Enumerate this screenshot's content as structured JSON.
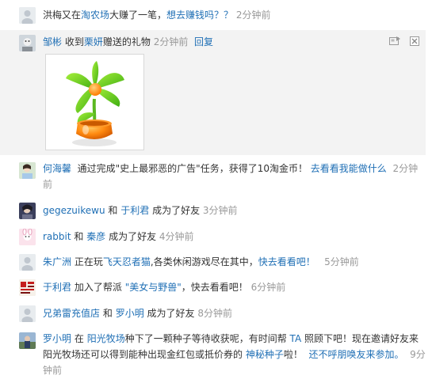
{
  "feed": [
    {
      "actor": "洪梅又在",
      "link1": "淘农场",
      "mid": "大赚了一笔，",
      "link2": "想去赚钱吗？？",
      "time": "2分钟前"
    },
    {
      "name": "邹彬",
      "t1": "收到",
      "name2": "栗妍",
      "t2": "赠送的礼物",
      "time": "2分钟前",
      "reply": "回复"
    },
    {
      "name": "何海馨",
      "t1": "通过完成\"史上最邪恶的广告\"任务，获得了10淘金币！",
      "link": "去看看我能做什么",
      "time": "2分钟前"
    },
    {
      "name": "gegezuikewu",
      "t1": "和",
      "name2": "于利君",
      "t2": "成为了好友",
      "time": "3分钟前"
    },
    {
      "name": "rabbit",
      "t1": "和",
      "name2": "秦彦",
      "t2": "成为了好友",
      "time": "4分钟前"
    },
    {
      "name": "朱广洲",
      "t1": "正在玩",
      "game": "飞天忍者猫",
      "t2": ",各类休闲游戏尽在其中，",
      "link": "快去看看吧！",
      "time": "5分钟前"
    },
    {
      "name": "于利君",
      "t1": "加入了帮派",
      "gang": "\"美女与野兽\"",
      "t2": "，快去看看吧！",
      "time": "6分钟前"
    },
    {
      "name": "兄弟雷充值店",
      "t1": "和",
      "name2": "罗小明",
      "t2": "成为了好友",
      "time": "8分钟前"
    },
    {
      "name": "罗小明",
      "t1": "在",
      "place": "阳光牧场",
      "t2": "种下了一颗种子等待收获呢，有时间帮",
      "ta": "TA",
      "t3": "照顾下吧！现在邀请好友来阳光牧场还可以得到能种出现金红包或抵价券的",
      "seed": "神秘种子",
      "t4": "啦！",
      "invite": "还不呼朋唤友来参加。",
      "time": "9分钟前"
    }
  ],
  "colors": {
    "link": "#1f6fb5",
    "time": "#999999",
    "highlight": "#f3f3f3"
  }
}
